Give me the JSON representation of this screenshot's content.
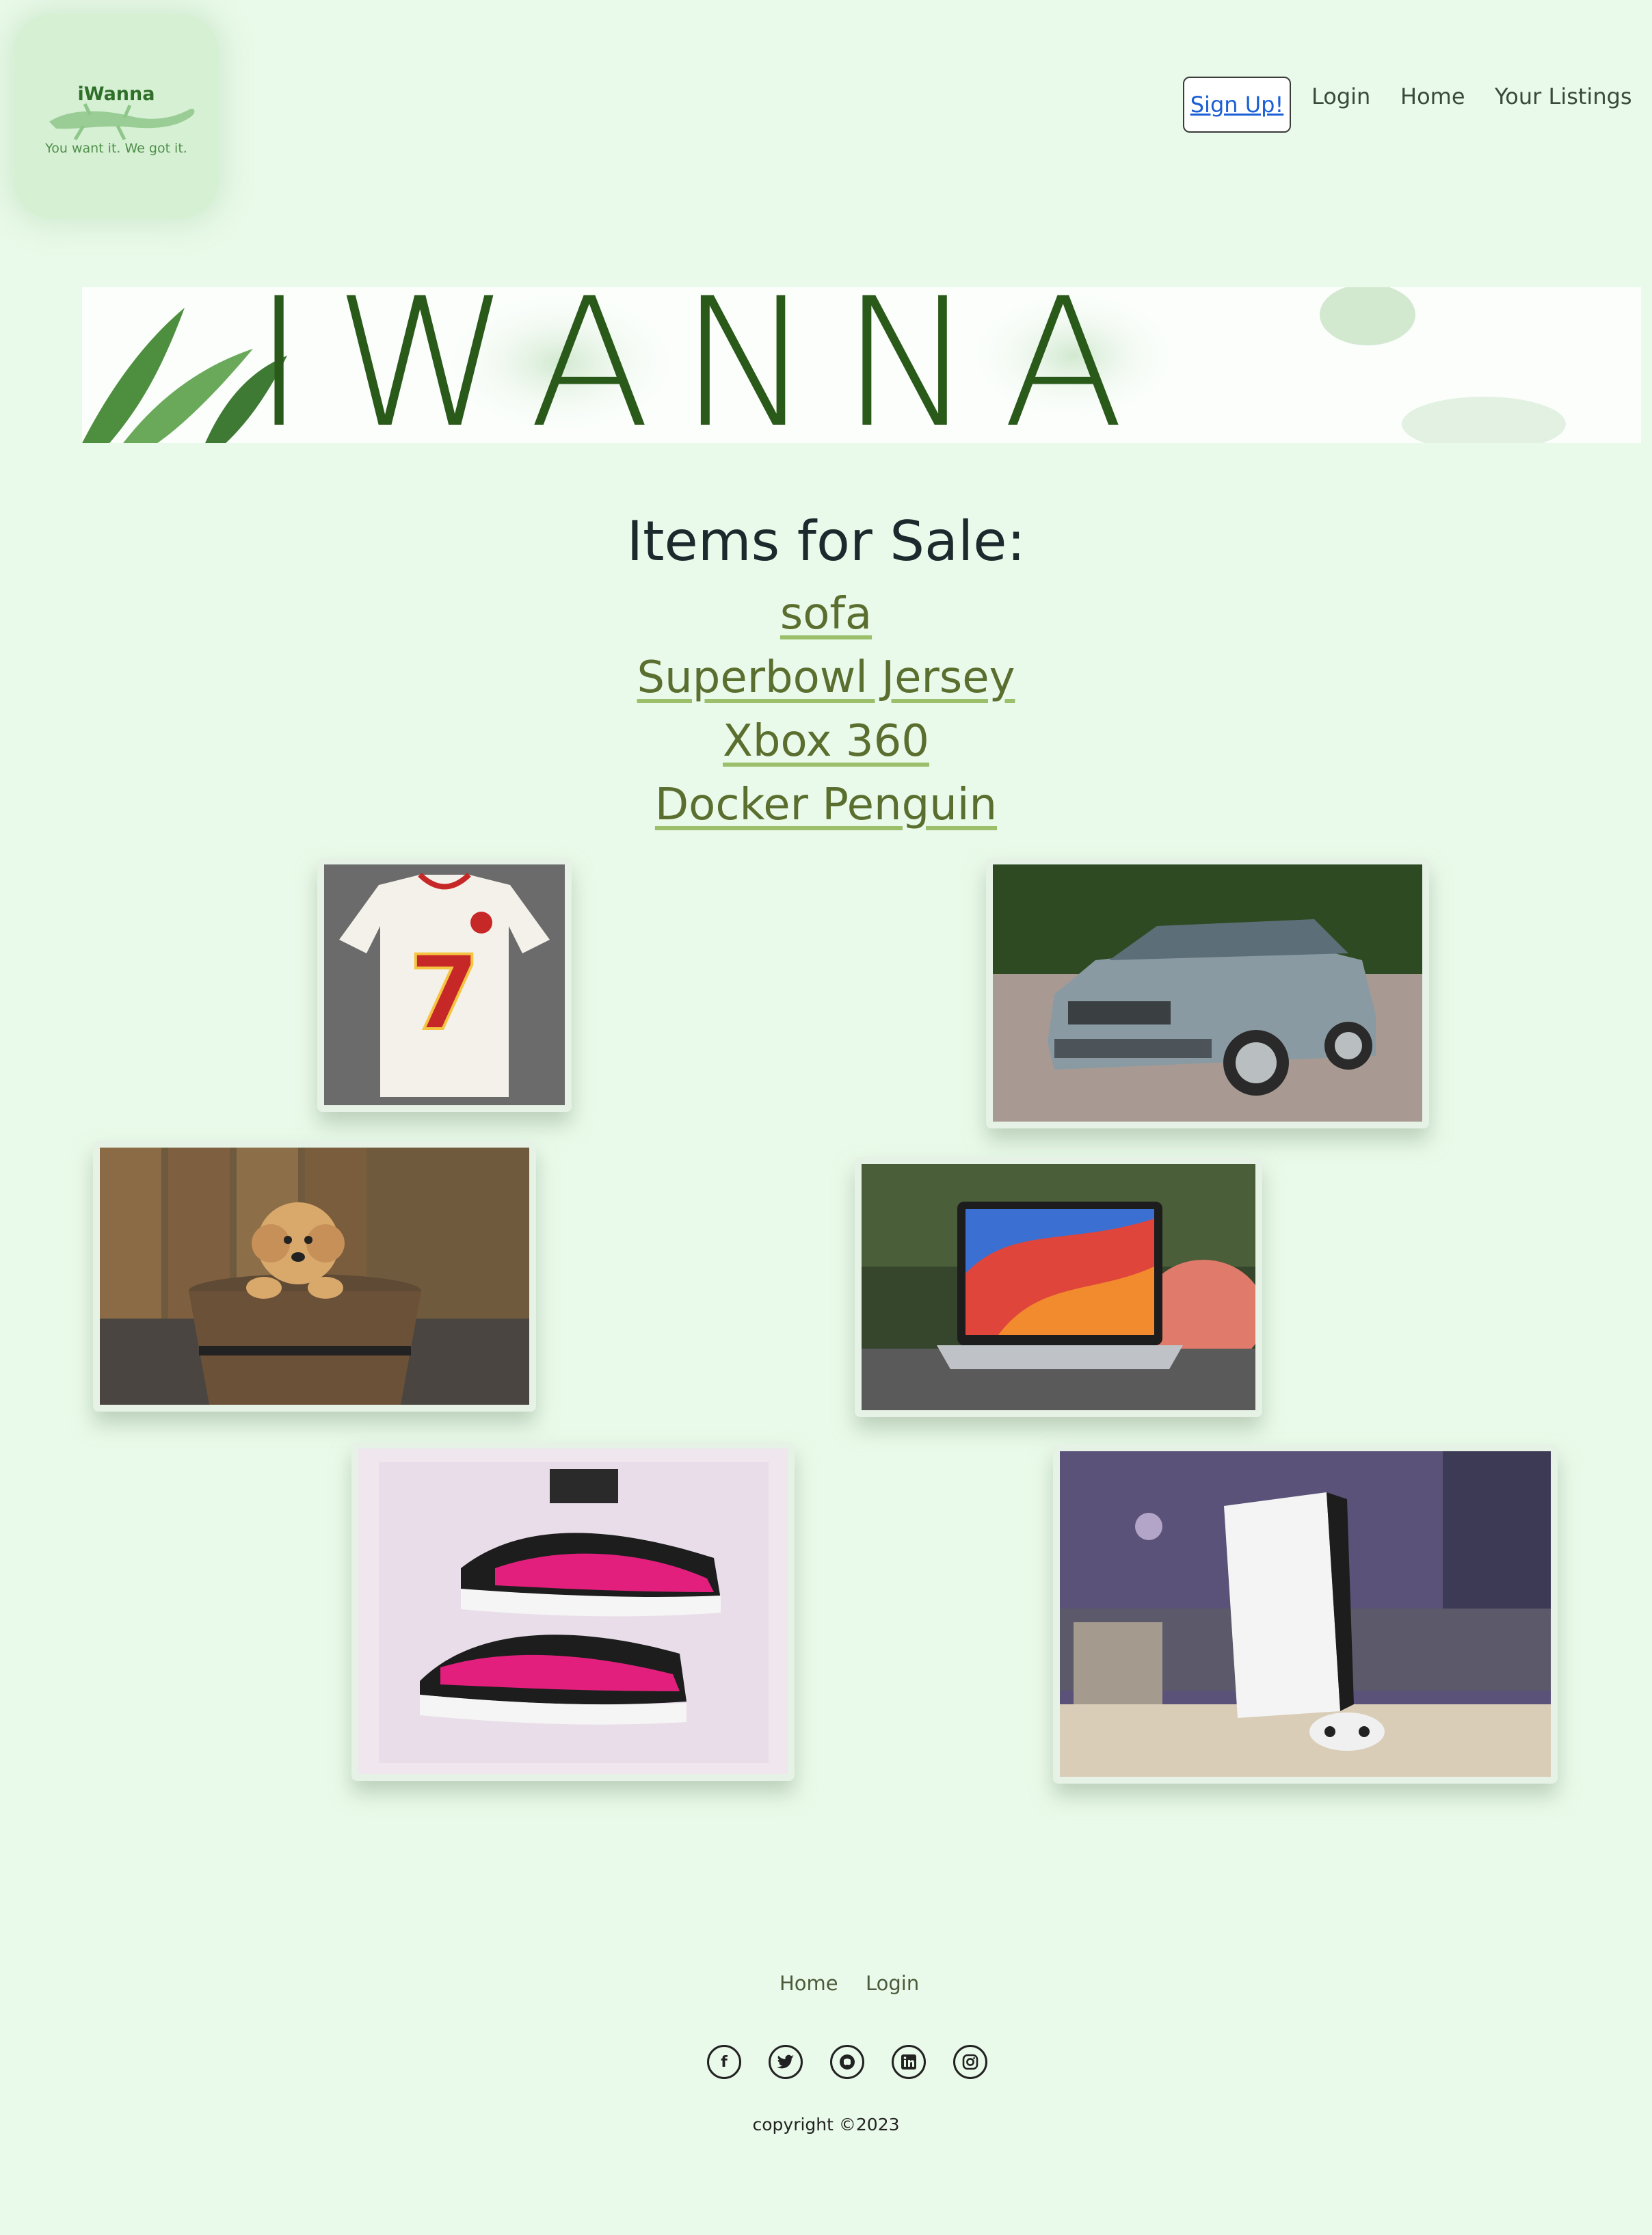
{
  "logo": {
    "title": "iWanna",
    "tagline": "You want it. We got it."
  },
  "nav": {
    "signup": "Sign Up!",
    "login": "Login",
    "home": "Home",
    "listings": "Your Listings"
  },
  "banner": {
    "text": "IWANNA"
  },
  "main": {
    "heading": "Items for Sale:",
    "items": [
      "sofa",
      "Superbowl Jersey",
      "Xbox 360",
      "Docker Penguin"
    ]
  },
  "footer": {
    "links": [
      "Home",
      "Login"
    ],
    "social": [
      "facebook-icon",
      "twitter-icon",
      "github-icon",
      "linkedin-icon",
      "instagram-icon"
    ],
    "copyright": "copyright ©2023"
  },
  "colors": {
    "background": "#eafaea",
    "link": "#5a6e2f",
    "banner_text": "#2a5a1a",
    "signup_text": "#1a5fd6"
  }
}
